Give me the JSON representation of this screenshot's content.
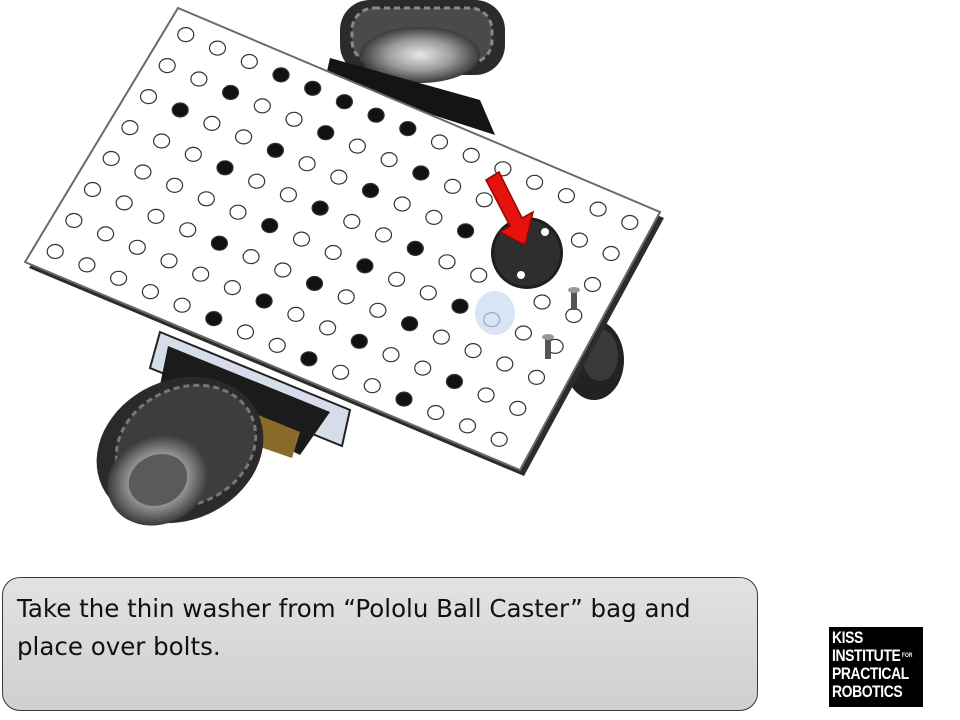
{
  "slide": {
    "caption": {
      "line1": "Take the thin washer from “Pololu Ball Caster” bag and",
      "line2": "place over bolts."
    },
    "logo": {
      "line1": "KISS",
      "line2": "INSTITUTE",
      "line2_superscript": "FOR",
      "line3": "PRACTICAL",
      "line4": "ROBOTICS"
    },
    "colors": {
      "arrow": "#e8120c",
      "plate": "#ffffff",
      "holes": "#111111",
      "caption_background": "#d9d9d9",
      "logo_background": "#000000"
    },
    "icons": {
      "pointer": "red-arrow-icon"
    }
  }
}
